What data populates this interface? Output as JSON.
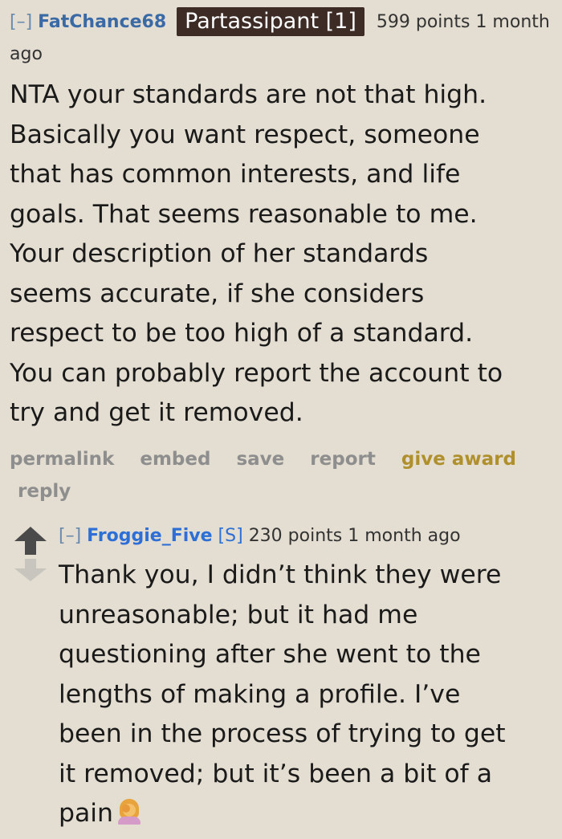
{
  "comment": {
    "expand": "[–]",
    "author": "FatChance68",
    "flair": "Partassipant [1]",
    "score": "599 points",
    "time": "1 month ago",
    "body": "NTA your standards are not that high.\nBasically you want respect, someone\nthat has common interests, and life\ngoals. That seems reasonable to me.\nYour description of her standards\nseems accurate, if she considers\nrespect to be too high of a standard.\nYou can probably report the account to\ntry and get it removed.",
    "buttons": {
      "permalink": "permalink",
      "embed": "embed",
      "save": "save",
      "report": "report",
      "give_award": "give award",
      "reply": "reply"
    }
  },
  "reply": {
    "expand": "[–]",
    "author": "Froggie_Five",
    "submitter_tag": "[S]",
    "score": "230 points",
    "time": "1 month ago",
    "body": "Thank you, I didn’t think they were\nunreasonable; but it had me\nquestioning after she went to the\nlengths of making a profile. I’ve\nbeen in the process of trying to get\nit removed; but it’s been a bit of a\npain",
    "emoji_icon": "facepalm-person-emoji"
  },
  "colors": {
    "background": "#e4ddd1",
    "author_link": "#3a6aa6",
    "flair_bg": "#3d2b26",
    "award": "#b0902c",
    "button_gray": "#8e8e8e",
    "upvote": "#4a4a4a",
    "downvote": "#c8c4be"
  }
}
